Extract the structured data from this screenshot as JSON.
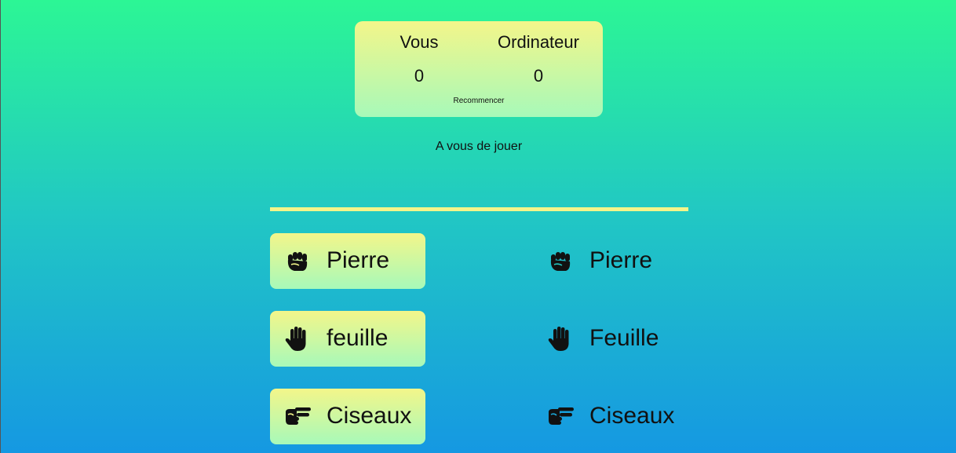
{
  "scoreboard": {
    "player_label": "Vous",
    "computer_label": "Ordinateur",
    "player_score": "0",
    "computer_score": "0",
    "restart_label": "Recommencer"
  },
  "status": {
    "message": "A vous de jouer"
  },
  "player_choices": [
    {
      "label": "Pierre",
      "icon": "rock-fist-icon"
    },
    {
      "label": "feuille",
      "icon": "paper-hand-icon"
    },
    {
      "label": "Ciseaux",
      "icon": "scissors-hand-icon"
    }
  ],
  "computer_choices": [
    {
      "label": "Pierre",
      "icon": "rock-fist-icon"
    },
    {
      "label": "Feuille",
      "icon": "paper-hand-icon"
    },
    {
      "label": "Ciseaux",
      "icon": "scissors-hand-icon"
    }
  ],
  "colors": {
    "gradient_top": "#2cf695",
    "gradient_bottom": "#1598e2",
    "card_top": "#f3f68a",
    "card_bottom": "#a7f9b9",
    "divider": "#f3f58a"
  }
}
